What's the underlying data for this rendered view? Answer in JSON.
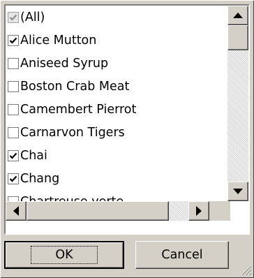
{
  "items": [
    {
      "label": "(All)",
      "state": "mixed"
    },
    {
      "label": "Alice Mutton",
      "state": "checked"
    },
    {
      "label": "Aniseed Syrup",
      "state": "unchecked"
    },
    {
      "label": "Boston Crab Meat",
      "state": "unchecked"
    },
    {
      "label": "Camembert Pierrot",
      "state": "unchecked"
    },
    {
      "label": "Carnarvon Tigers",
      "state": "unchecked"
    },
    {
      "label": "Chai",
      "state": "checked"
    },
    {
      "label": "Chang",
      "state": "checked"
    },
    {
      "label": "Chartreuse verte",
      "state": "unchecked"
    }
  ],
  "buttons": {
    "ok": "OK",
    "cancel": "Cancel"
  },
  "icons": {
    "scroll_up": "arrow-up-icon",
    "scroll_down": "arrow-down-icon",
    "scroll_left": "arrow-left-icon",
    "scroll_right": "arrow-right-icon",
    "resize": "resize-grip-icon"
  }
}
